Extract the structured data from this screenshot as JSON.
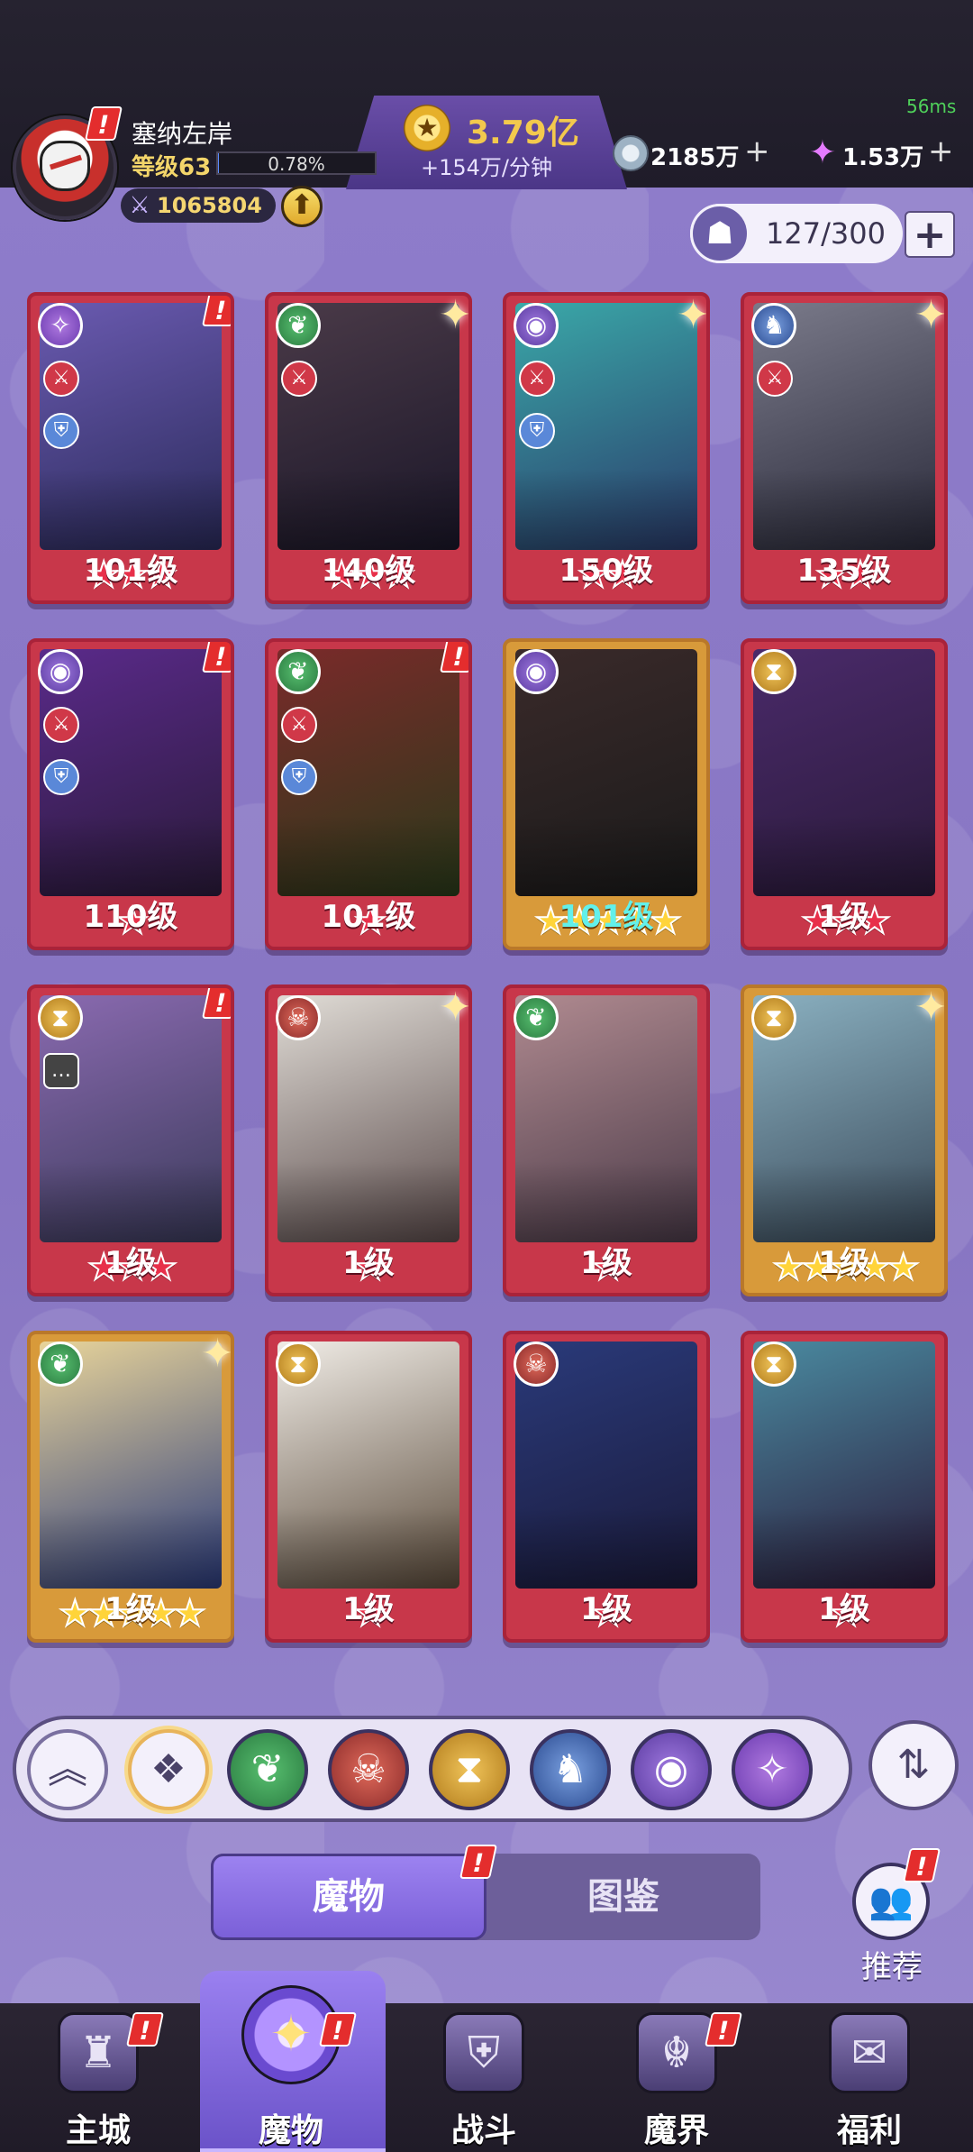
{
  "player": {
    "name": "塞纳左岸",
    "level": "等级63",
    "exp_percent": "0.78%",
    "exp_fraction": 0.0078,
    "power": "1065804"
  },
  "currency": {
    "gold": "3.79亿",
    "gold_rate": "+154万/分钟",
    "crystal": "2185万",
    "gem": "1.53万",
    "add_symbol": "+"
  },
  "ping": "56ms",
  "capacity": {
    "text": "127/300",
    "add_symbol": "+"
  },
  "icons": {
    "power": "sword-icon",
    "up": "arrow-up-icon",
    "capacity": "monster-head-icon",
    "sort": "sort-icon",
    "collapse": "chevron-double-up-icon",
    "all": "all-diamond-icon"
  },
  "alert_symbol": "!",
  "cards": [
    {
      "level": "101级",
      "frame": "red",
      "element": "void",
      "stars": 3,
      "star_color": "red",
      "badges": [
        "atk",
        "def"
      ],
      "alert": true,
      "sparkle": false
    },
    {
      "level": "140级",
      "frame": "red",
      "element": "leaf",
      "stars": 3,
      "star_color": "red",
      "badges": [
        "atk"
      ],
      "alert": false,
      "sparkle": true
    },
    {
      "level": "150级",
      "frame": "red",
      "element": "eye",
      "stars": 2,
      "star_color": "red",
      "badges": [
        "atk",
        "def"
      ],
      "alert": false,
      "sparkle": true
    },
    {
      "level": "135级",
      "frame": "red",
      "element": "dragon",
      "stars": 2,
      "star_color": "red",
      "badges": [
        "atk"
      ],
      "alert": false,
      "sparkle": true
    },
    {
      "level": "110级",
      "frame": "red",
      "element": "eye",
      "stars": 1,
      "star_color": "red",
      "badges": [
        "atk",
        "def"
      ],
      "alert": true,
      "sparkle": false
    },
    {
      "level": "101级",
      "frame": "red",
      "element": "leaf",
      "stars": 1,
      "star_color": "red",
      "badges": [
        "atk",
        "def"
      ],
      "alert": true,
      "sparkle": false
    },
    {
      "level": "101级",
      "frame": "gold",
      "element": "eye",
      "stars": 5,
      "star_color": "gold",
      "badges": [],
      "alert": false,
      "sparkle": false,
      "teal": true
    },
    {
      "level": "1级",
      "frame": "red",
      "element": "sand",
      "stars": 3,
      "star_color": "red",
      "badges": [],
      "alert": false,
      "sparkle": false
    },
    {
      "level": "1级",
      "frame": "red",
      "element": "sand",
      "stars": 3,
      "star_color": "red",
      "badges": [
        "chat"
      ],
      "alert": true,
      "sparkle": false
    },
    {
      "level": "1级",
      "frame": "red",
      "element": "demon",
      "stars": 1,
      "star_color": "red",
      "badges": [],
      "alert": false,
      "sparkle": true
    },
    {
      "level": "1级",
      "frame": "red",
      "element": "leaf",
      "stars": 1,
      "star_color": "red",
      "badges": [],
      "alert": false,
      "sparkle": false
    },
    {
      "level": "1级",
      "frame": "gold",
      "element": "sand",
      "stars": 5,
      "star_color": "gold",
      "badges": [],
      "alert": false,
      "sparkle": true
    },
    {
      "level": "1级",
      "frame": "gold",
      "element": "leaf",
      "stars": 5,
      "star_color": "gold",
      "badges": [],
      "alert": false,
      "sparkle": true
    },
    {
      "level": "1级",
      "frame": "red",
      "element": "sand",
      "stars": 1,
      "star_color": "red",
      "badges": [],
      "alert": false,
      "sparkle": false
    },
    {
      "level": "1级",
      "frame": "red",
      "element": "demon",
      "stars": 1,
      "star_color": "red",
      "badges": [],
      "alert": false,
      "sparkle": false
    },
    {
      "level": "1级",
      "frame": "red",
      "element": "sand",
      "stars": 1,
      "star_color": "red",
      "badges": [],
      "alert": false,
      "sparkle": false
    }
  ],
  "filters": [
    "leaf-element-icon",
    "demon-element-icon",
    "sand-element-icon",
    "dragon-element-icon",
    "eye-element-icon",
    "void-element-icon"
  ],
  "tabs": {
    "monster": "魔物",
    "codex": "图鉴"
  },
  "recommend_label": "推荐",
  "nav": [
    {
      "label": "主城",
      "icon": "castle-icon",
      "alert": true
    },
    {
      "label": "魔物",
      "icon": "monster-flame-icon",
      "alert": true
    },
    {
      "label": "战斗",
      "icon": "sword-shield-icon",
      "alert": false
    },
    {
      "label": "魔界",
      "icon": "demon-realm-icon",
      "alert": true
    },
    {
      "label": "福利",
      "icon": "gift-chest-icon",
      "alert": false
    }
  ],
  "colors": {
    "accent": "#8a78c4",
    "alert": "#e42d2d",
    "gold": "#f3c94d",
    "frame_red": "#c8374a",
    "frame_gold": "#d89a3a"
  }
}
